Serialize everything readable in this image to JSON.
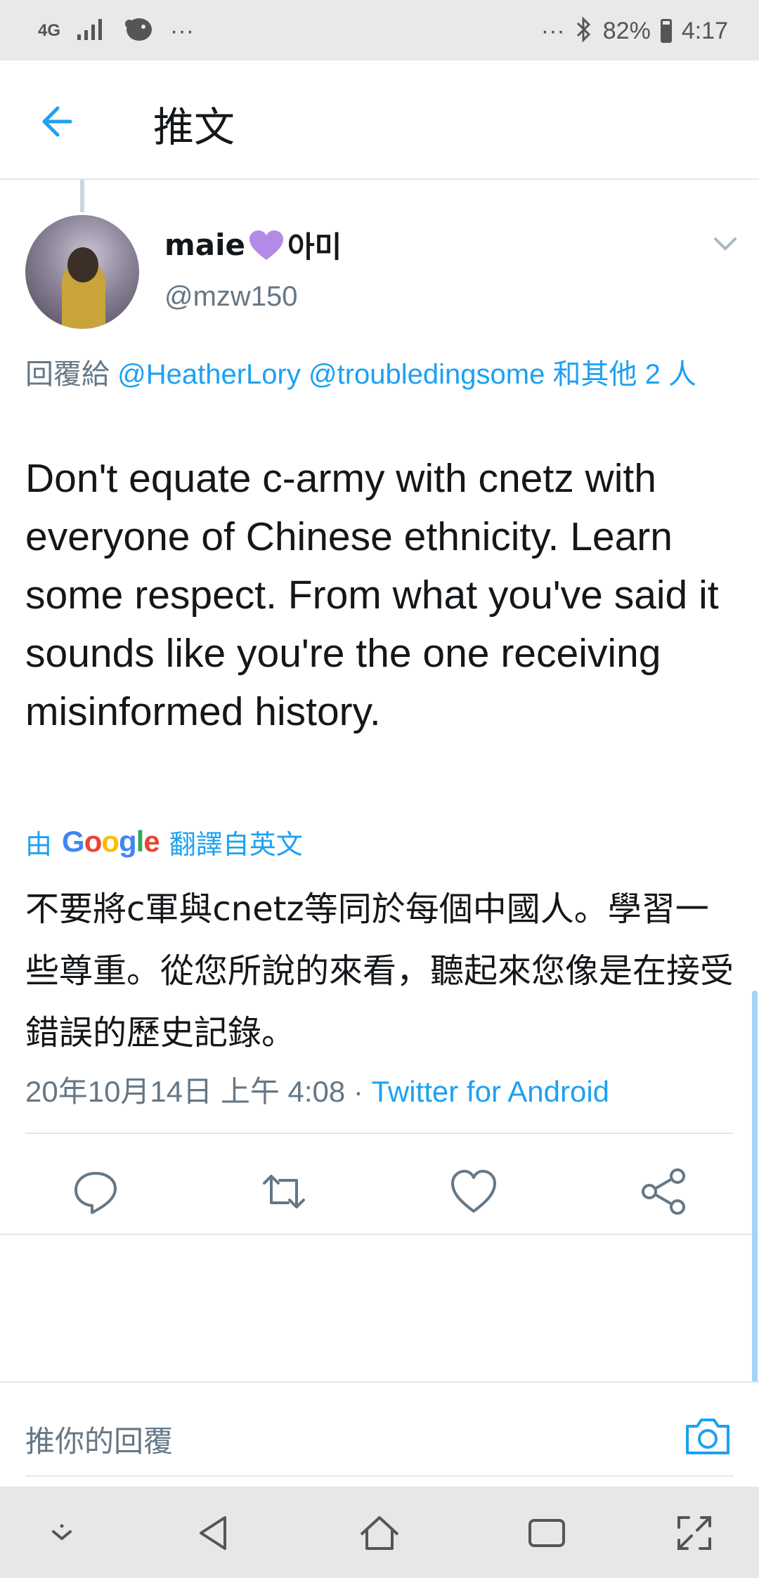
{
  "status_bar": {
    "network": "4G",
    "more": "···",
    "more_right": "···",
    "battery_percent": "82%",
    "battery_level": 0.82,
    "time": "4:17"
  },
  "header": {
    "title": "推文"
  },
  "tweet": {
    "display_name_prefix": "maie",
    "display_name_suffix": "아미",
    "handle": "@mzw150",
    "reply_prefix": "回覆給",
    "reply_mention_1": "@HeatherLory",
    "reply_mention_2": "@troubledingsome",
    "reply_others": "和其他 2 人",
    "text": "Don't equate c-army with cnetz with everyone of Chinese ethnicity. Learn some respect. From what you've said it sounds like you're the one receiving misinformed history.",
    "translate_by": "由",
    "translate_provider": "Google",
    "translate_from": "翻譯自英文",
    "translated_text": "不要將c軍與cnetz等同於每個中國人。學習一些尊重。從您所說的來看，聽起來您像是在接受錯誤的歷史記錄。",
    "timestamp": "20年10月14日 上午 4:08",
    "separator": " · ",
    "source": "Twitter for Android"
  },
  "reply_bar": {
    "placeholder": "推你的回覆"
  },
  "icons": {
    "back": "arrow-left-icon",
    "caret": "chevron-down-icon",
    "reply": "reply-icon",
    "retweet": "retweet-icon",
    "like": "heart-icon",
    "share": "share-icon",
    "camera": "camera-icon"
  },
  "colors": {
    "accent": "#1da1f2",
    "secondary_text": "#657786",
    "heart_emoji": "#b38ae6"
  }
}
